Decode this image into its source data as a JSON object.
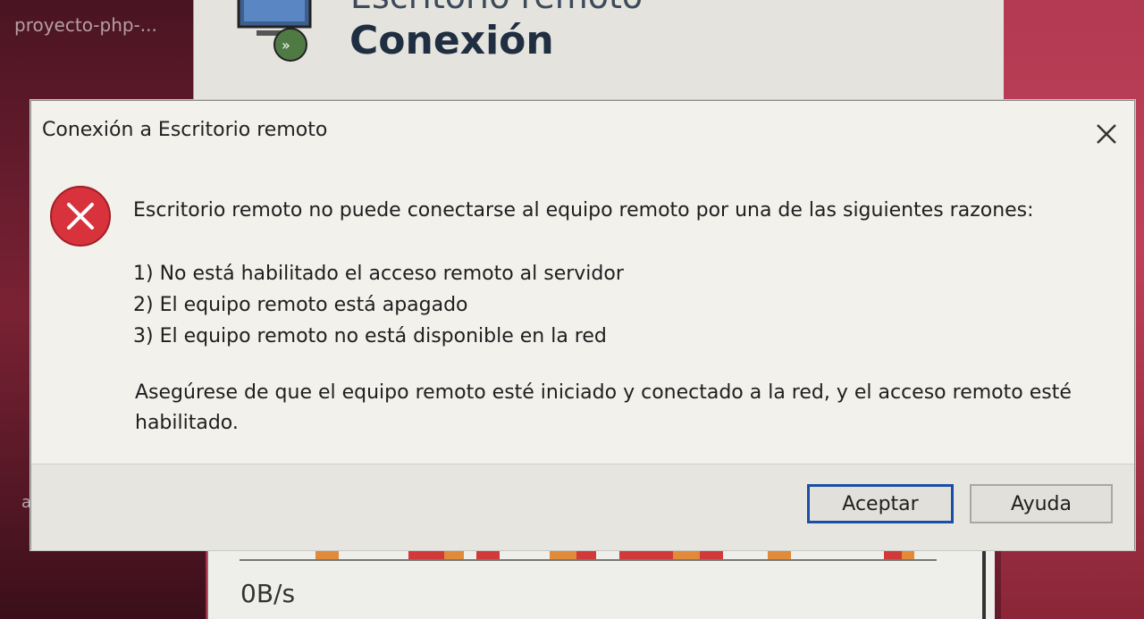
{
  "desktop": {
    "shortcut_label": "proyecto-php-...",
    "partial_letter": "a"
  },
  "rdp_window": {
    "subtitle": "Escritorio remoto",
    "title": "Conexión"
  },
  "task_manager": {
    "speed": "0B/s"
  },
  "dialog": {
    "title": "Conexión a Escritorio remoto",
    "intro": "Escritorio remoto no puede conectarse al equipo remoto por una de las siguientes razones:",
    "reasons": [
      "1) No está habilitado el acceso remoto al servidor",
      "2) El equipo remoto está apagado",
      "3) El equipo remoto no está disponible en la red"
    ],
    "advice": "Asegúrese de que el equipo remoto esté iniciado y conectado a la red, y el acceso remoto esté habilitado.",
    "buttons": {
      "accept": "Aceptar",
      "help": "Ayuda"
    }
  },
  "icons": {
    "error": "error-icon",
    "close": "close-icon",
    "rdp": "remote-desktop-icon"
  },
  "colors": {
    "error_red": "#d8333c",
    "focus_border": "#1a4ea8",
    "dialog_bg": "#f2f1ec"
  }
}
